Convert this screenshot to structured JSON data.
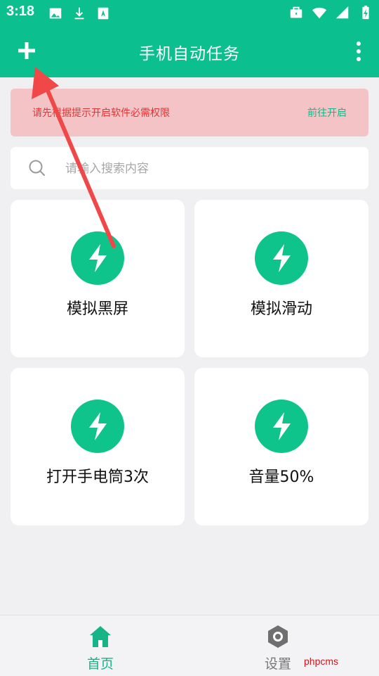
{
  "status_bar": {
    "time": "3:18",
    "left_icons": [
      "image-icon",
      "download-icon",
      "text-notification-icon"
    ],
    "right_icons": [
      "briefcase-icon",
      "wifi-icon",
      "signal-icon",
      "battery-charging-icon"
    ]
  },
  "app_bar": {
    "title": "手机自动任务",
    "left_action_icon": "plus-icon",
    "right_action_icon": "more-vertical-icon"
  },
  "permission_banner": {
    "message": "请先根据提示开启软件必需权限",
    "action_label": "前往开启"
  },
  "search": {
    "placeholder": "请输入搜索内容",
    "value": ""
  },
  "task_cards": [
    {
      "label": "模拟黑屏",
      "icon": "flash-icon"
    },
    {
      "label": "模拟滑动",
      "icon": "flash-icon"
    },
    {
      "label": "打开手电筒3次",
      "icon": "flash-icon"
    },
    {
      "label": "音量50%",
      "icon": "flash-icon"
    }
  ],
  "bottom_nav": {
    "items": [
      {
        "label": "首页",
        "icon": "home-icon",
        "active": true
      },
      {
        "label": "设置",
        "icon": "settings-hexagon-icon",
        "active": false
      }
    ]
  },
  "watermark": {
    "text": "phpcms"
  },
  "colors": {
    "primary": "#0bbf8f",
    "accent_green": "#0fc48a",
    "banner_background": "#f3c3c5",
    "banner_text": "#e03535",
    "annotation_arrow": "#f04848",
    "page_background": "#f0f0f2"
  }
}
